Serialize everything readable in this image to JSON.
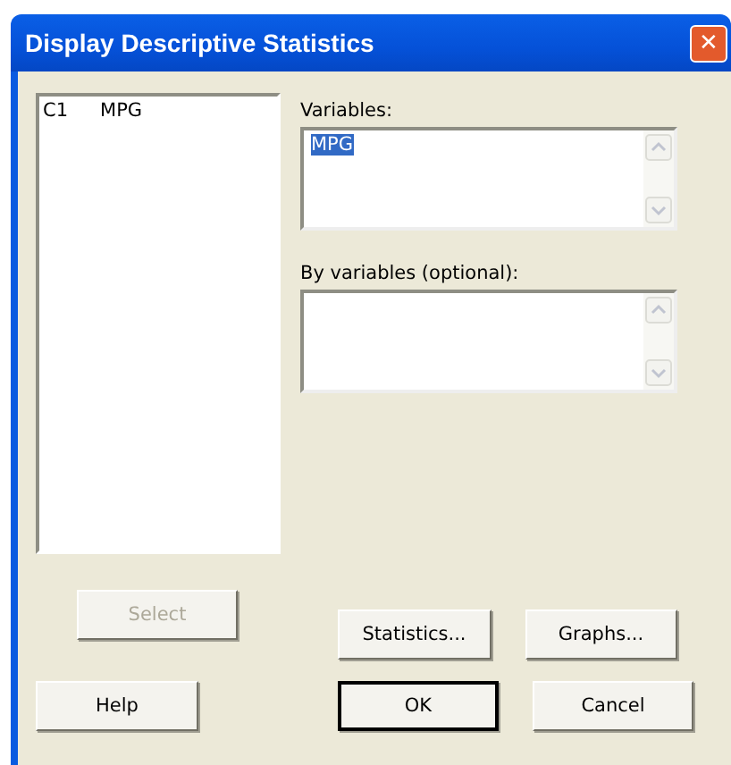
{
  "window": {
    "title": "Display Descriptive Statistics",
    "close": "✕"
  },
  "columns": [
    {
      "number": "C1",
      "name": "MPG",
      "selected": false
    }
  ],
  "fields": [
    {
      "label": "Variables:",
      "value": "MPG",
      "selected": true
    },
    {
      "label": "By variables (optional):"
    }
  ],
  "select_button": {
    "label": "Select",
    "disabled": true,
    "default": false
  },
  "option_buttons": [
    {
      "label": "Statistics...",
      "disabled": false,
      "default": false
    },
    {
      "label": "Graphs...",
      "disabled": false,
      "default": false
    }
  ],
  "help_button": {
    "label": "Help",
    "disabled": false,
    "default": false
  },
  "footer_buttons": [
    {
      "label": "OK",
      "disabled": false,
      "default": true
    },
    {
      "label": "Cancel",
      "disabled": false,
      "default": false
    }
  ]
}
